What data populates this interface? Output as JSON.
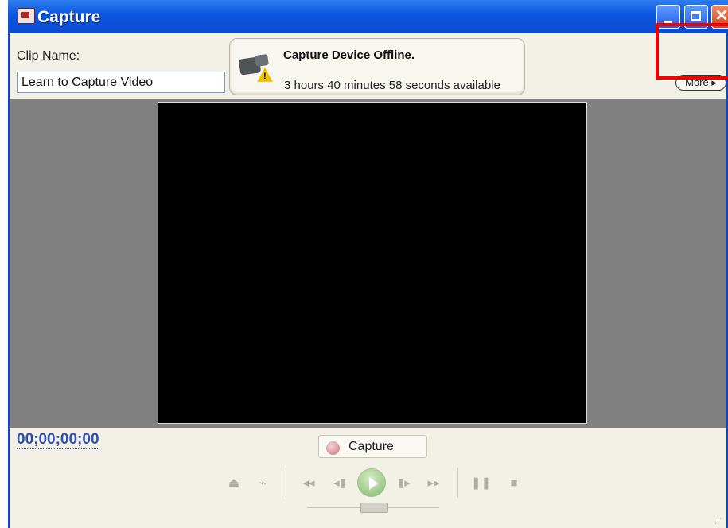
{
  "window": {
    "title": "Capture",
    "buttons": {
      "close_glyph": "✕"
    }
  },
  "clip": {
    "label": "Clip Name:",
    "value": "Learn to Capture Video"
  },
  "status": {
    "title": "Capture Device Offline.",
    "time_available": "3 hours 40 minutes 58 seconds available",
    "warning_glyph": "!"
  },
  "more_button": {
    "label": "More ▸"
  },
  "timecode": "00;00;00;00",
  "capture_button": {
    "label": "Capture"
  },
  "transport": {
    "controls": [
      {
        "name": "eject-icon",
        "glyph": "⏏"
      },
      {
        "name": "camera-off-icon",
        "glyph": "⌁"
      },
      {
        "name": "rewind-icon",
        "glyph": "◂◂"
      },
      {
        "name": "step-back-icon",
        "glyph": "◂▮"
      },
      {
        "name": "step-forward-icon",
        "glyph": "▮▸"
      },
      {
        "name": "fast-forward-icon",
        "glyph": "▸▸"
      },
      {
        "name": "pause-icon",
        "glyph": "❚❚"
      },
      {
        "name": "stop-icon",
        "glyph": "■"
      }
    ]
  },
  "colors": {
    "title_bar": "#0a55e0",
    "timecode": "#2d50b8",
    "highlight": "#f20000",
    "play": "#7eb86a"
  }
}
